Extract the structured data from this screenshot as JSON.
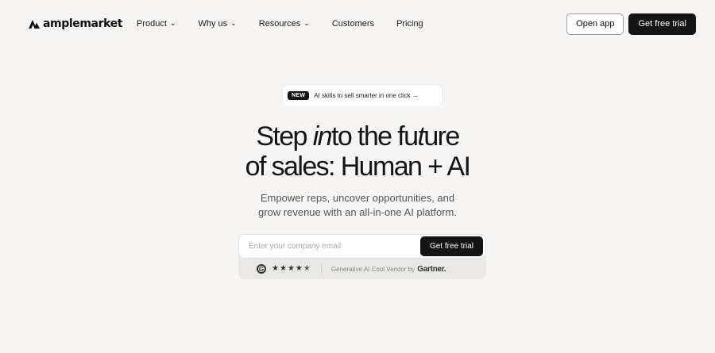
{
  "nav": {
    "logo_text": "amplemarket",
    "menu": [
      {
        "label": "Product",
        "has_dropdown": true
      },
      {
        "label": "Why us",
        "has_dropdown": true
      },
      {
        "label": "Resources",
        "has_dropdown": true
      },
      {
        "label": "Customers",
        "has_dropdown": false
      },
      {
        "label": "Pricing",
        "has_dropdown": false
      }
    ],
    "open_app_label": "Open app",
    "trial_label": "Get free trial"
  },
  "badge": {
    "tag": "NEW",
    "text": "AI skills to sell smarter in one click →"
  },
  "hero": {
    "headline_line1_a": "Step ",
    "headline_line1_em": "in",
    "headline_line1_b": "to the fu",
    "headline_line1_em2": "t",
    "headline_line1_c": "ure",
    "headline_line2": "of sales: Human + AI",
    "subtitle_line1": "Empower reps, uncover opportunities, and",
    "subtitle_line2": "grow revenue with an all-in-one AI platform."
  },
  "form": {
    "email_placeholder": "Enter your company email",
    "email_value": "",
    "submit_label": "Get free trial"
  },
  "social_proof": {
    "g2_letter": "G",
    "rating": 4.5,
    "rating_max": 5,
    "text": "Generative AI Cool Vendor by",
    "brand": "Gartner."
  },
  "colors": {
    "background": "#f6f5f3",
    "primary": "#141414",
    "text_muted": "#555555"
  }
}
